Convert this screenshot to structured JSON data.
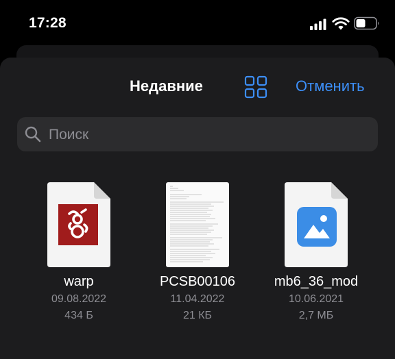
{
  "status_bar": {
    "time": "17:28"
  },
  "header": {
    "title": "Недавние",
    "cancel_label": "Отменить"
  },
  "search": {
    "placeholder": "Поиск"
  },
  "files": [
    {
      "name": "warp",
      "date": "09.08.2022",
      "size": "434 Б"
    },
    {
      "name": "PCSB00106",
      "date": "11.04.2022",
      "size": "21 КБ"
    },
    {
      "name": "mb6_36_mod",
      "date": "10.06.2021",
      "size": "2,7 МБ"
    }
  ],
  "colors": {
    "accent": "#3c8ef7",
    "sheet": "#1c1c1e",
    "search_bg": "#2c2c2e",
    "warp_red": "#a01c1c",
    "image_blue": "#3b8de6"
  },
  "icons": {
    "signal": "cellular-signal-icon",
    "wifi": "wifi-icon",
    "battery": "battery-icon",
    "grid": "grid-view-icon",
    "search": "search-icon"
  }
}
